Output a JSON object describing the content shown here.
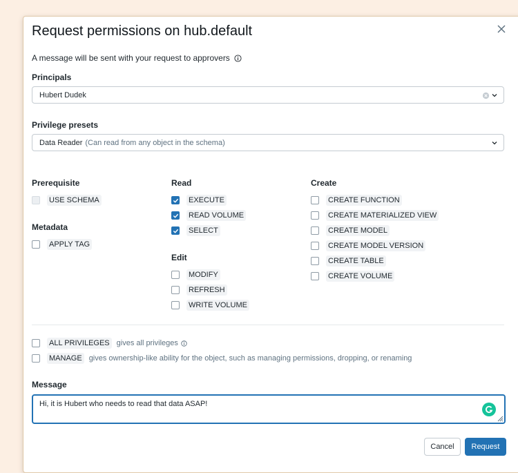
{
  "dialog": {
    "title": "Request permissions on hub.default",
    "info_text": "A message will be sent with your request to approvers"
  },
  "principals": {
    "label": "Principals",
    "value": "Hubert Dudek"
  },
  "presets": {
    "label": "Privilege presets",
    "value": "Data Reader",
    "hint": "(Can read from any object in the schema)"
  },
  "groups": {
    "prerequisite": {
      "heading": "Prerequisite",
      "items": [
        {
          "label": "USE SCHEMA",
          "checked": false,
          "disabled": true
        }
      ]
    },
    "metadata": {
      "heading": "Metadata",
      "items": [
        {
          "label": "APPLY TAG",
          "checked": false
        }
      ]
    },
    "read": {
      "heading": "Read",
      "items": [
        {
          "label": "EXECUTE",
          "checked": true
        },
        {
          "label": "READ VOLUME",
          "checked": true
        },
        {
          "label": "SELECT",
          "checked": true
        }
      ]
    },
    "edit": {
      "heading": "Edit",
      "items": [
        {
          "label": "MODIFY",
          "checked": false
        },
        {
          "label": "REFRESH",
          "checked": false
        },
        {
          "label": "WRITE VOLUME",
          "checked": false
        }
      ]
    },
    "create": {
      "heading": "Create",
      "items": [
        {
          "label": "CREATE FUNCTION",
          "checked": false
        },
        {
          "label": "CREATE MATERIALIZED VIEW",
          "checked": false
        },
        {
          "label": "CREATE MODEL",
          "checked": false
        },
        {
          "label": "CREATE MODEL VERSION",
          "checked": false
        },
        {
          "label": "CREATE TABLE",
          "checked": false
        },
        {
          "label": "CREATE VOLUME",
          "checked": false
        }
      ]
    }
  },
  "special": {
    "all_privileges": {
      "label": "ALL PRIVILEGES",
      "desc": "gives all privileges"
    },
    "manage": {
      "label": "MANAGE",
      "desc": "gives ownership-like ability for the object, such as managing permissions, dropping, or renaming"
    }
  },
  "message": {
    "label": "Message",
    "value": "Hi, it is Hubert who needs to read that data ASAP!"
  },
  "buttons": {
    "cancel": "Cancel",
    "request": "Request"
  },
  "colors": {
    "accent": "#2272b4",
    "backdrop": "#fcefe3"
  }
}
